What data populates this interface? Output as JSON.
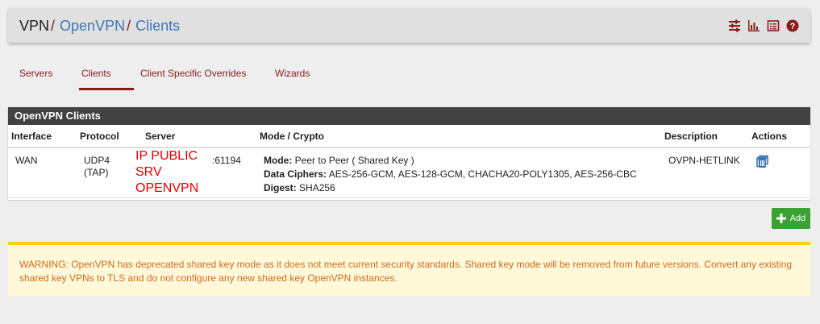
{
  "breadcrumb": {
    "root": "VPN",
    "separator": "/",
    "section": "OpenVPN",
    "page": "Clients"
  },
  "header_icons": [
    "sliders-icon",
    "bar-chart-icon",
    "list-icon",
    "help-icon"
  ],
  "tabs": [
    {
      "label": "Servers",
      "active": false
    },
    {
      "label": "Clients",
      "active": true
    },
    {
      "label": "Client Specific Overrides",
      "active": false
    },
    {
      "label": "Wizards",
      "active": false
    }
  ],
  "panel": {
    "title": "OpenVPN Clients",
    "columns": [
      "Interface",
      "Protocol",
      "Server",
      "Mode / Crypto",
      "Description",
      "Actions"
    ],
    "rows": [
      {
        "interface": "WAN",
        "protocol_line1": "UDP4",
        "protocol_line2": "(TAP)",
        "server_overlay_1": "IP PUBLIC",
        "server_overlay_2": "SRV",
        "server_overlay_3": "OPENVPN",
        "server_port": ":61194",
        "mode_label": "Mode:",
        "mode_value": "Peer to Peer ( Shared Key )",
        "ciphers_label": "Data Ciphers:",
        "ciphers_value": "AES-256-GCM, AES-128-GCM, CHACHA20-POLY1305, AES-256-CBC",
        "digest_label": "Digest:",
        "digest_value": "SHA256",
        "description": "OVPN-HETLINK"
      }
    ]
  },
  "add_button": {
    "label": "Add"
  },
  "warning": {
    "text": "WARNING: OpenVPN has deprecated shared key mode as it does not meet current security standards. Shared key mode will be removed from future versions. Convert any existing shared key VPNs to TLS and do not configure any new shared key OpenVPN instances."
  },
  "colors": {
    "brand_red": "#8b1a1a",
    "link_blue": "#3d77b5",
    "add_green": "#3aa132",
    "warning_orange": "#d2691e",
    "warning_bar": "#f5d208"
  }
}
